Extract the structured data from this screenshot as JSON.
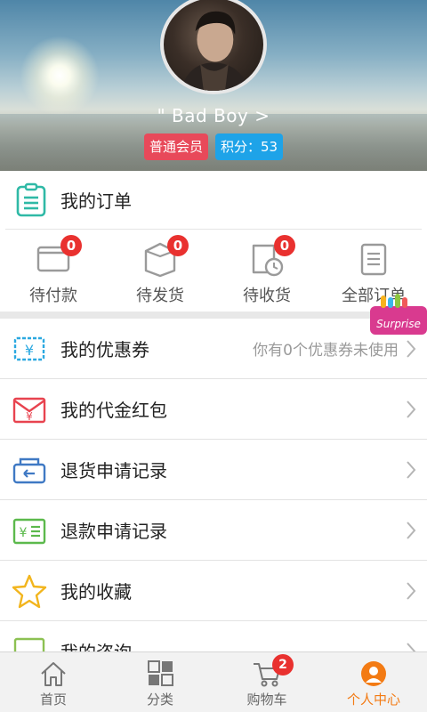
{
  "profile": {
    "username": "\" Bad Boy >",
    "member_badge": "普通会员",
    "points_badge": "积分：53"
  },
  "orders": {
    "title": "我的订单",
    "statuses": [
      {
        "label": "待付款",
        "count": "0"
      },
      {
        "label": "待发货",
        "count": "0"
      },
      {
        "label": "待收货",
        "count": "0"
      },
      {
        "label": "全部订单"
      }
    ]
  },
  "surprise_tag": "Surprise",
  "menu": {
    "items": [
      {
        "label": "我的优惠券",
        "hint": "你有0个优惠券未使用",
        "icon": "coupon-icon"
      },
      {
        "label": "我的代金红包",
        "icon": "red-envelope-icon"
      },
      {
        "label": "退货申请记录",
        "icon": "return-icon"
      },
      {
        "label": "退款申请记录",
        "icon": "refund-icon"
      },
      {
        "label": "我的收藏",
        "icon": "star-icon"
      },
      {
        "label": "我的咨询",
        "icon": "consult-icon"
      }
    ]
  },
  "tabbar": {
    "tabs": [
      {
        "label": "首页",
        "icon": "home-icon"
      },
      {
        "label": "分类",
        "icon": "category-icon"
      },
      {
        "label": "购物车",
        "icon": "cart-icon",
        "badge": "2"
      },
      {
        "label": "个人中心",
        "icon": "user-icon",
        "active": true
      }
    ]
  },
  "colors": {
    "accent": "#f37b14",
    "badge_red": "#e9312f",
    "member_badge_bg": "#e8495a",
    "points_badge_bg": "#1ea3e8"
  }
}
